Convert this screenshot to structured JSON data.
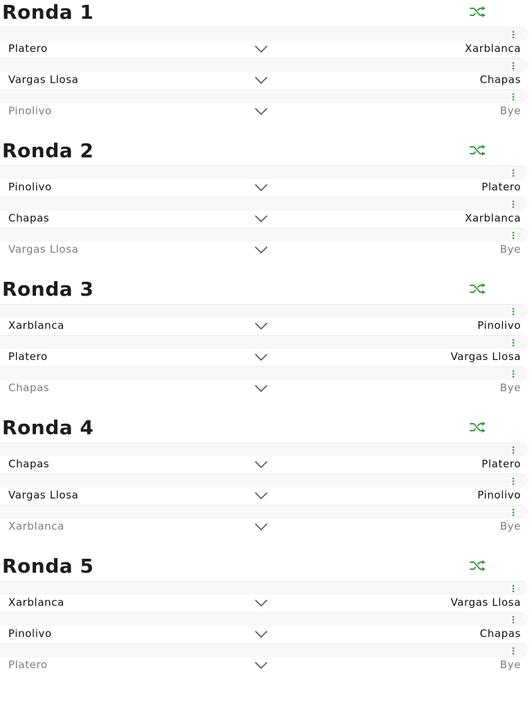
{
  "colors": {
    "accent": "#3a9a3a",
    "text": "#111111",
    "muted": "#7d7d7d",
    "band": "#f7f7f7"
  },
  "icons": {
    "shuffle": "shuffle-icon",
    "more": "more-vertical-icon",
    "chevron": "chevron-down-icon"
  },
  "rounds": [
    {
      "title": "Ronda 1",
      "matches": [
        {
          "home": "Platero",
          "away": "Xarblanca",
          "bye": false
        },
        {
          "home": "Vargas Llosa",
          "away": "Chapas",
          "bye": false
        },
        {
          "home": "Pinolivo",
          "away": "Bye",
          "bye": true
        }
      ]
    },
    {
      "title": "Ronda 2",
      "matches": [
        {
          "home": "Pinolivo",
          "away": "Platero",
          "bye": false
        },
        {
          "home": "Chapas",
          "away": "Xarblanca",
          "bye": false
        },
        {
          "home": "Vargas Llosa",
          "away": "Bye",
          "bye": true
        }
      ]
    },
    {
      "title": "Ronda 3",
      "matches": [
        {
          "home": "Xarblanca",
          "away": "Pinolivo",
          "bye": false
        },
        {
          "home": "Platero",
          "away": "Vargas Llosa",
          "bye": false
        },
        {
          "home": "Chapas",
          "away": "Bye",
          "bye": true
        }
      ]
    },
    {
      "title": "Ronda 4",
      "matches": [
        {
          "home": "Chapas",
          "away": "Platero",
          "bye": false
        },
        {
          "home": "Vargas Llosa",
          "away": "Pinolivo",
          "bye": false
        },
        {
          "home": "Xarblanca",
          "away": "Bye",
          "bye": true
        }
      ]
    },
    {
      "title": "Ronda 5",
      "matches": [
        {
          "home": "Xarblanca",
          "away": "Vargas Llosa",
          "bye": false
        },
        {
          "home": "Pinolivo",
          "away": "Chapas",
          "bye": false
        },
        {
          "home": "Platero",
          "away": "Bye",
          "bye": true
        }
      ]
    }
  ]
}
